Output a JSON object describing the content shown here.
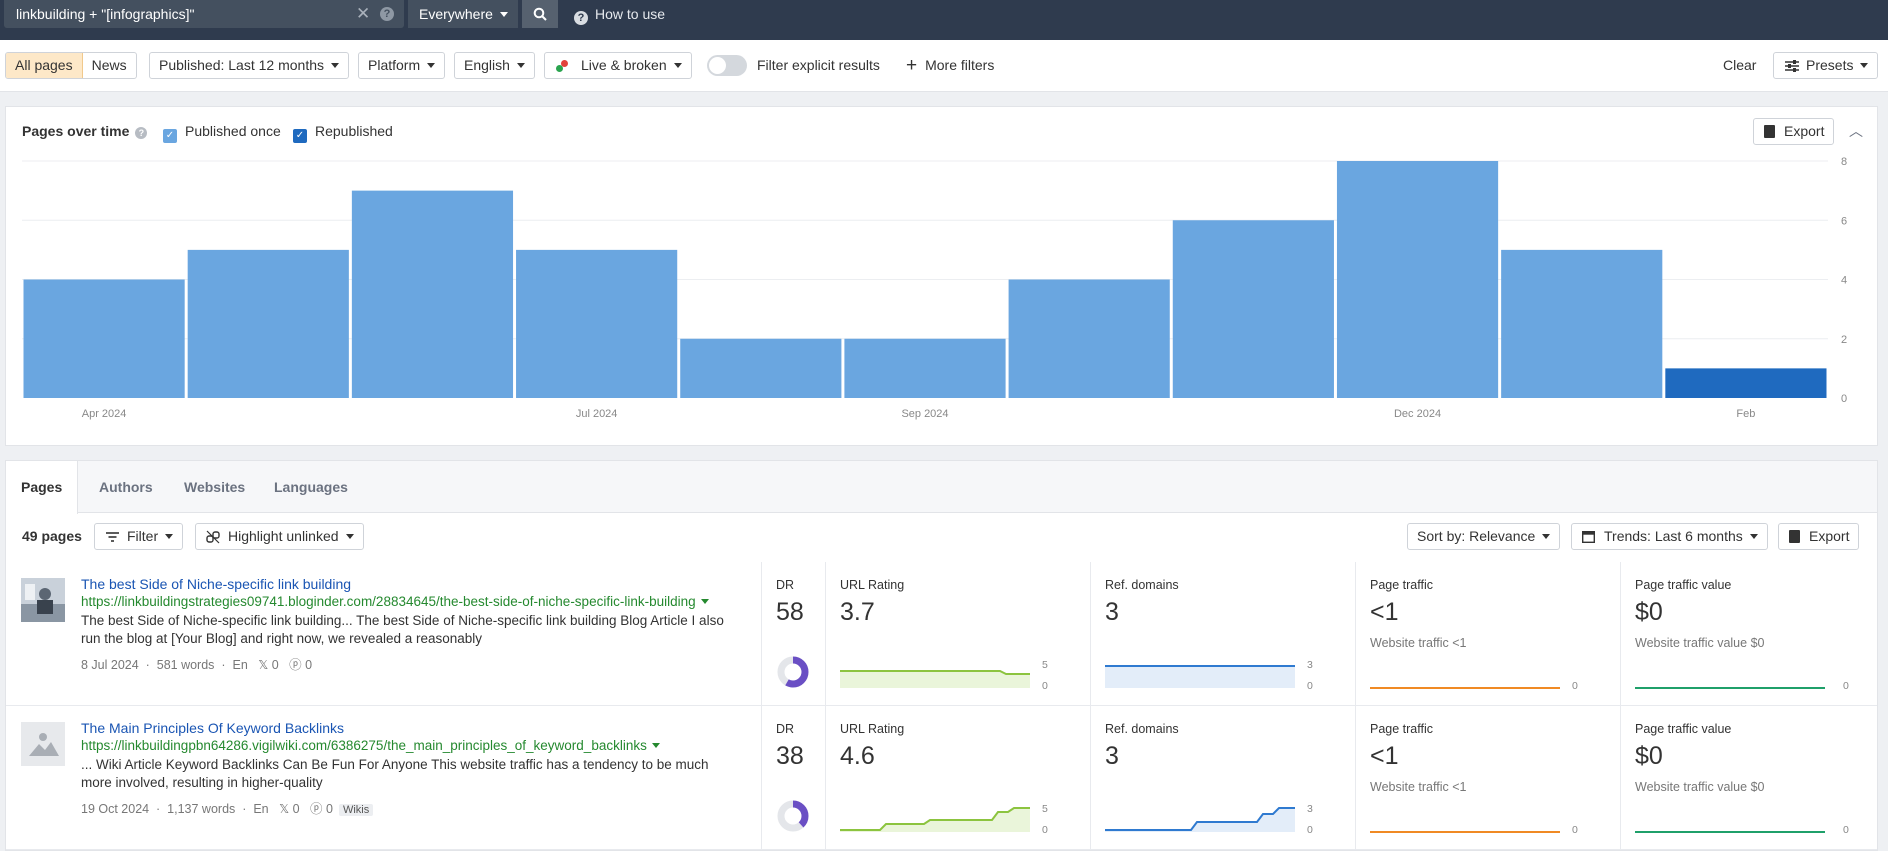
{
  "search": {
    "query": "linkbuilding + \"[infographics]\"",
    "scope": "Everywhere",
    "how_to": "How to use"
  },
  "filters": {
    "all_pages": "All pages",
    "news": "News",
    "published": "Published: Last 12 months",
    "platform": "Platform",
    "language": "English",
    "live_broken": "Live & broken",
    "explicit": "Filter explicit results",
    "more": "More filters",
    "clear": "Clear",
    "presets": "Presets"
  },
  "chart_panel": {
    "title": "Pages over time",
    "legend_once": "Published once",
    "legend_republished": "Republished",
    "export": "Export"
  },
  "chart_data": {
    "type": "bar",
    "x_labels": [
      "Apr 2024",
      "Jul 2024",
      "Sep 2024",
      "Dec 2024",
      "Feb"
    ],
    "y_ticks": [
      "8",
      "6",
      "4",
      "2",
      "0"
    ],
    "ylim": [
      0,
      8
    ],
    "grid": true,
    "series": [
      {
        "name": "Published once",
        "color": "#6aa6e0",
        "values": [
          4,
          5,
          7,
          5,
          2,
          2,
          4,
          6,
          8,
          5,
          0
        ]
      },
      {
        "name": "Republished",
        "color": "#1f6abf",
        "values": [
          0,
          0,
          0,
          0,
          0,
          0,
          0,
          0,
          0,
          0,
          1
        ]
      }
    ]
  },
  "tabs": [
    "Pages",
    "Authors",
    "Websites",
    "Languages"
  ],
  "toolbar": {
    "count": "49 pages",
    "filter": "Filter",
    "highlight": "Highlight unlinked",
    "sort": "Sort by: Relevance",
    "trends": "Trends: Last 6 months",
    "export": "Export"
  },
  "rows": [
    {
      "title": "The best Side of Niche-specific link building",
      "url": "https://linkbuildingstrategies09741.bloginder.com/28834645/the-best-side-of-niche-specific-link-building",
      "desc": "The best Side of Niche-specific link building... The best Side of Niche-specific link building Blog Article I also run the blog at [Your Blog] and right now, we revealed a reasonably",
      "date": "8 Jul 2024",
      "words": "581 words",
      "lang": "En",
      "x_shares": "0",
      "pins": "0",
      "badge": "",
      "dr_label": "DR",
      "dr": "58",
      "dr_fraction": 0.58,
      "ur_label": "URL Rating",
      "ur": "3.7",
      "ur_max": "5",
      "ur_min": "0",
      "rd_label": "Ref. domains",
      "rd": "3",
      "rd_max": "3",
      "rd_min": "0",
      "pt_label": "Page traffic",
      "pt": "<1",
      "pt_sub": "Website traffic <1",
      "pt_min": "0",
      "ptv_label": "Page traffic value",
      "ptv": "$0",
      "ptv_sub": "Website traffic value $0",
      "ptv_min": "0"
    },
    {
      "title": "The Main Principles Of Keyword Backlinks",
      "url": "https://linkbuildingpbn64286.vigilwiki.com/6386275/the_main_principles_of_keyword_backlinks",
      "desc": "... Wiki Article Keyword Backlinks Can Be Fun For Anyone This website traffic has a tendency to be much more involved, resulting in higher-quality",
      "date": "19 Oct 2024",
      "words": "1,137 words",
      "lang": "En",
      "x_shares": "0",
      "pins": "0",
      "badge": "Wikis",
      "dr_label": "DR",
      "dr": "38",
      "dr_fraction": 0.38,
      "ur_label": "URL Rating",
      "ur": "4.6",
      "ur_max": "5",
      "ur_min": "0",
      "rd_label": "Ref. domains",
      "rd": "3",
      "rd_max": "3",
      "rd_min": "0",
      "pt_label": "Page traffic",
      "pt": "<1",
      "pt_sub": "Website traffic <1",
      "pt_min": "0",
      "ptv_label": "Page traffic value",
      "ptv": "$0",
      "ptv_sub": "Website traffic value $0",
      "ptv_min": "0"
    }
  ]
}
